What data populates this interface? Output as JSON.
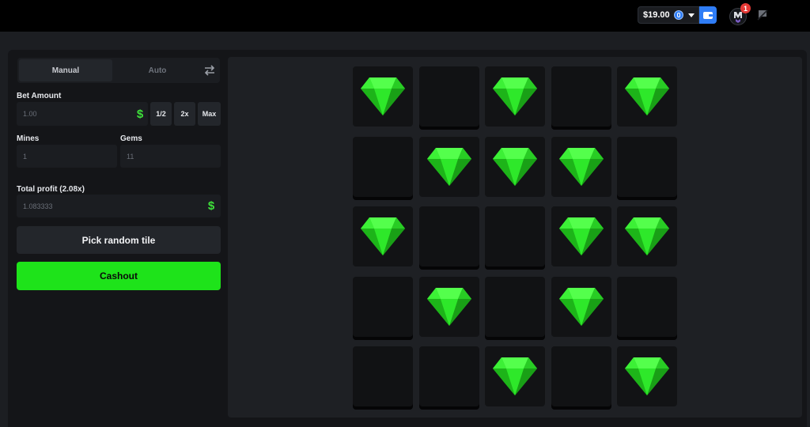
{
  "header": {
    "balance": "$19.00",
    "notification_count": "1"
  },
  "sidebar": {
    "tabs": [
      "Manual",
      "Auto"
    ],
    "active_tab": "Manual",
    "bet_amount": {
      "label": "Bet Amount",
      "placeholder": "1.00",
      "buttons": [
        "1/2",
        "2x",
        "Max"
      ]
    },
    "mines": {
      "label": "Mines",
      "placeholder": "1"
    },
    "gems": {
      "label": "Gems",
      "placeholder": "11"
    },
    "total_profit": {
      "label": "Total profit (2.08x)",
      "placeholder": "1.083333"
    },
    "pick_random_label": "Pick random tile",
    "cashout_label": "Cashout"
  },
  "board": {
    "rows": 5,
    "cols": 5,
    "tiles": [
      [
        "gem",
        "hidden",
        "gem",
        "hidden",
        "gem"
      ],
      [
        "hidden",
        "gem",
        "gem",
        "gem",
        "hidden"
      ],
      [
        "gem",
        "hidden",
        "hidden",
        "gem",
        "gem"
      ],
      [
        "hidden",
        "gem",
        "hidden",
        "gem",
        "hidden"
      ],
      [
        "hidden",
        "hidden",
        "gem",
        "hidden",
        "gem"
      ]
    ]
  },
  "colors": {
    "accent_green": "#1ee31a",
    "gem_green": "#2ee82a",
    "wallet_blue": "#2f7df6",
    "badge_red": "#e53935"
  },
  "icons": {
    "wallet": "wallet-icon",
    "coin": "coin-icon",
    "swap": "swap-icon",
    "dollar": "dollar-icon",
    "gem": "gem-icon",
    "chat": "chat-icon"
  }
}
